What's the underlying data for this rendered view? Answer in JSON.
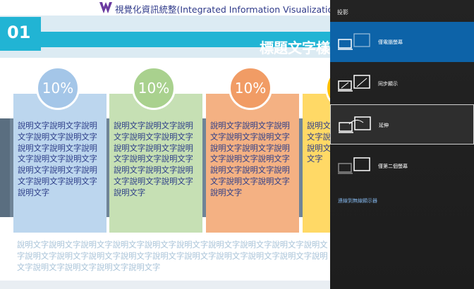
{
  "slide": {
    "top_title": "視覺化資訊統整(Integrated Information Visualization)",
    "section_number": "01",
    "heading": "標題文字樣",
    "cards": [
      {
        "percent": "10%",
        "text": "說明文字說明文字說明文字說明文字說明文字說明文字說明文字說明文字說明文字說明文字說明文字說明文字說明文字說明文字說明文字說明文字",
        "color": "#bcd6ee",
        "circle": "#a4c6e8"
      },
      {
        "percent": "10%",
        "text": "說明文字說明文字說明文字說明文字說明文字說明文字說明文字說明文字說明文字說明文字說明文字說明文字說明文字說明文字說明文字說明文字",
        "color": "#c6e0b4",
        "circle": "#a9d18e"
      },
      {
        "percent": "10%",
        "text": "說明文字說明文字說明文字說明文字說明文字說明文字說明文字說明文字說明文字說明文字說明文字說明文字說明文字說明文字說明文字說明文字",
        "color": "#f4b183",
        "circle": "#f19c65"
      },
      {
        "percent": "",
        "text": "說明文字說明文字說明文字說明文字說明文字說明文字說明文字說明文字",
        "color": "#ffd966",
        "circle": "#ffc000"
      }
    ],
    "bottom_text": "說明文字說明文字說明文字說明文字說明文字說明文字說明文字說明文字說明文字說明文字說明文字說明文字說明文字說明文字說明文字說明文字說明文字說明文字說明文字說明文字說明文字說明文字說明文字說明文字"
  },
  "project_panel": {
    "title": "投影",
    "options": [
      {
        "label": "僅電腦螢幕",
        "icon": "pc-screen-only-icon",
        "state": "selected"
      },
      {
        "label": "同步顯示",
        "icon": "duplicate-icon",
        "state": "normal"
      },
      {
        "label": "延伸",
        "icon": "extend-icon",
        "state": "hover"
      },
      {
        "label": "僅第二個螢幕",
        "icon": "second-screen-only-icon",
        "state": "normal"
      }
    ],
    "wireless_link": "連線到無線顯示器",
    "accent": "#0d63a8"
  }
}
